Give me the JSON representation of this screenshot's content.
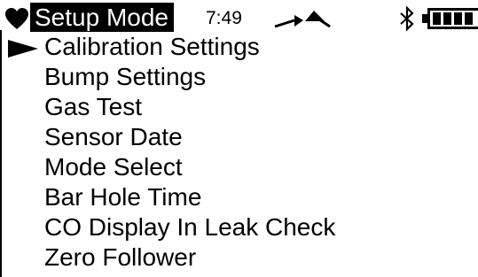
{
  "status": {
    "mode_title": "Setup Mode",
    "time": "7:49",
    "icons": [
      "heart-icon",
      "signal-icon",
      "bluetooth-icon",
      "battery-icon"
    ]
  },
  "menu": {
    "selected_index": 0,
    "items": [
      {
        "label": "Calibration Settings"
      },
      {
        "label": "Bump Settings"
      },
      {
        "label": "Gas Test"
      },
      {
        "label": "Sensor Date"
      },
      {
        "label": "Mode Select"
      },
      {
        "label": "Bar Hole Time"
      },
      {
        "label": "CO Display In Leak Check"
      },
      {
        "label": "Zero Follower"
      }
    ]
  }
}
